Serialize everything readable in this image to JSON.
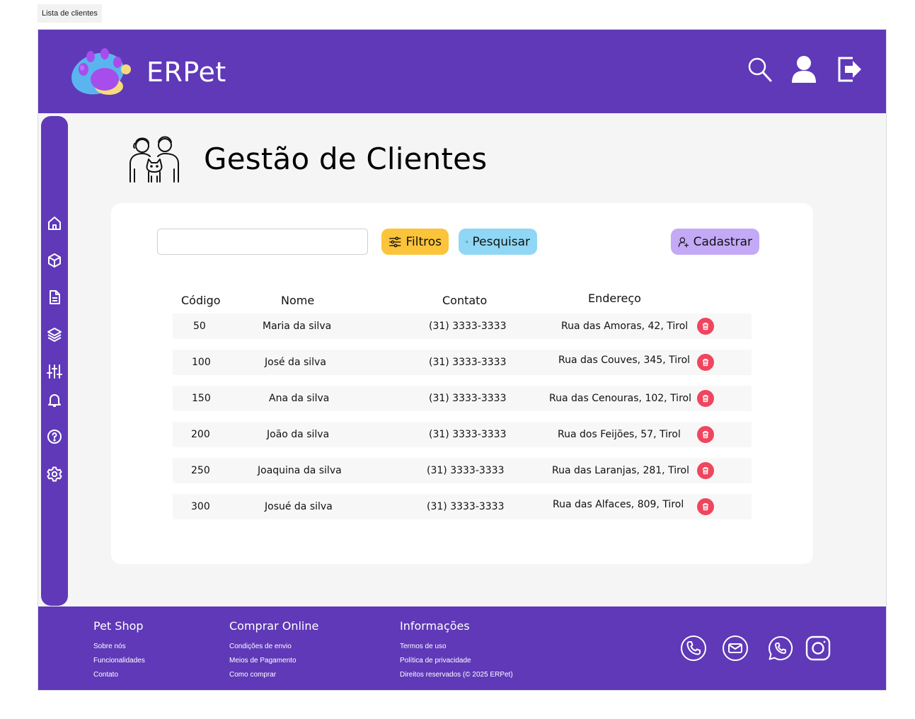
{
  "frame_label": "Lista de clientes",
  "header": {
    "brand": "ERPet"
  },
  "page": {
    "title": "Gestão de Clientes"
  },
  "toolbar": {
    "search_value": "",
    "filter_label": "Filtros",
    "search_label": "Pesquisar",
    "register_label": "Cadastrar"
  },
  "table": {
    "headers": {
      "code": "Código",
      "name": "Nome",
      "contact": "Contato",
      "address": "Endereço"
    },
    "rows": [
      {
        "code": "50",
        "name": "Maria da silva",
        "contact": "(31) 3333-3333",
        "address": "Rua das Amoras, 42, Tirol"
      },
      {
        "code": "100",
        "name": "José da silva",
        "contact": "(31) 3333-3333",
        "address": "Rua das Couves, 345, Tirol"
      },
      {
        "code": "150",
        "name": "Ana da silva",
        "contact": "(31) 3333-3333",
        "address": "Rua das Cenouras, 102, Tirol"
      },
      {
        "code": "200",
        "name": "João da silva",
        "contact": "(31) 3333-3333",
        "address": "Rua dos Feijões, 57, Tirol"
      },
      {
        "code": "250",
        "name": "Joaquina da silva",
        "contact": "(31) 3333-3333",
        "address": "Rua das Laranjas, 281, Tirol"
      },
      {
        "code": "300",
        "name": "Josué da silva",
        "contact": "(31) 3333-3333",
        "address": "Rua das Alfaces, 809, Tirol"
      }
    ]
  },
  "footer": {
    "col1": {
      "title": "Pet Shop",
      "links": [
        "Sobre nós",
        "Funcionalidades",
        "Contato"
      ]
    },
    "col2": {
      "title": "Comprar Online",
      "links": [
        "Condições de envio",
        "Meios de Pagamento",
        "Como comprar"
      ]
    },
    "col3": {
      "title": "Informações",
      "links": [
        "Termos de uso",
        "Política de privacidade",
        "Direitos reservados (© 2025 ERPet)"
      ]
    }
  },
  "colors": {
    "brand_purple": "#5f39b8",
    "filter_yellow": "#fbc43a",
    "search_blue": "#8fd7f4",
    "register_lilac": "#c3a9f6",
    "delete_red": "#f0455e"
  },
  "icons": {
    "header": [
      "search-icon",
      "user-icon",
      "logout-icon"
    ],
    "sidebar": [
      "home-icon",
      "box-icon",
      "document-icon",
      "layers-icon",
      "sliders-icon",
      "bell-icon",
      "help-icon",
      "settings-icon"
    ],
    "social": [
      "phone-icon",
      "mail-icon",
      "whatsapp-icon",
      "instagram-icon"
    ]
  }
}
